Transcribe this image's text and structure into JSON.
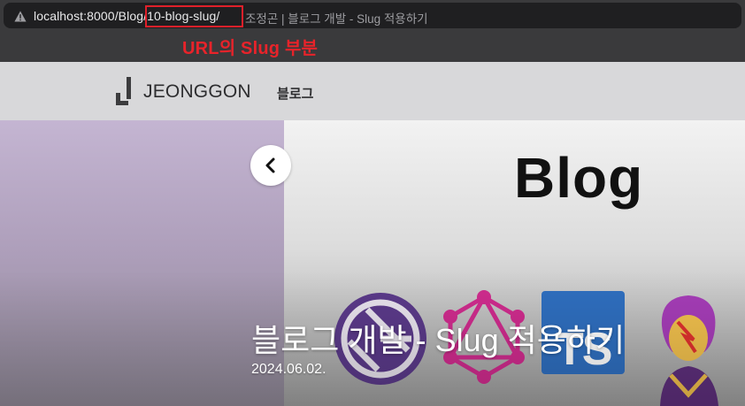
{
  "browser": {
    "url_base": "localhost:8000/Blog",
    "url_slug": "/10-blog-slug/",
    "tab_title": "조정곤 | 블로그 개발 - Slug 적용하기",
    "warning_icon": "warning-triangle-icon"
  },
  "annotation": {
    "text": "URL의 Slug 부분",
    "color": "#e8232a"
  },
  "site": {
    "logo_text": "JEONGGON",
    "nav_blog": "블로그"
  },
  "hero": {
    "image_word": "Blog",
    "ts_label": "TS",
    "post_title": "블로그 개발 - Slug 적용하기",
    "post_date": "2024.06.02.",
    "prev_icon": "chevron-left-icon"
  }
}
